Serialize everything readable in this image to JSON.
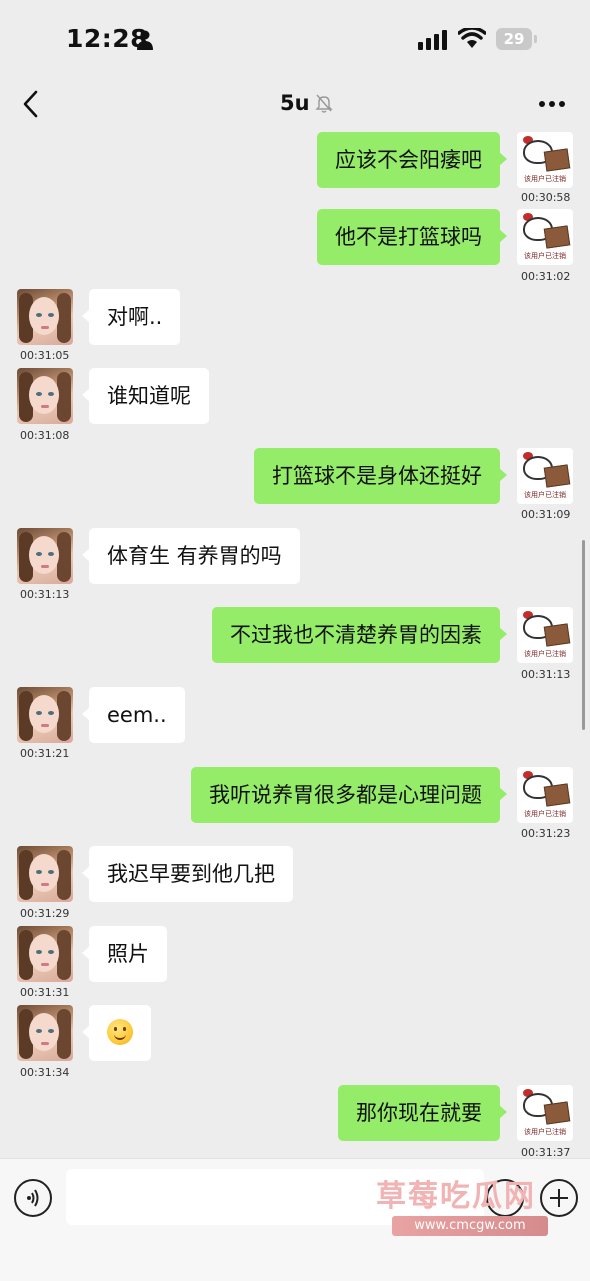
{
  "status_bar": {
    "time": "12:28",
    "battery": "29"
  },
  "header": {
    "title": "5u"
  },
  "watermark": {
    "text": "草莓吃瓜网",
    "url": "www.cmcgw.com"
  },
  "messages": [
    {
      "side": "out",
      "text": "应该不会阳痿吧",
      "time": "00:30:58"
    },
    {
      "side": "out",
      "text": "他不是打篮球吗",
      "time": "00:31:02"
    },
    {
      "side": "in",
      "text": "对啊..",
      "time": "00:31:05"
    },
    {
      "side": "in",
      "text": "谁知道呢",
      "time": "00:31:08"
    },
    {
      "side": "out",
      "text": "打篮球不是身体还挺好",
      "time": "00:31:09"
    },
    {
      "side": "in",
      "text": "体育生 有养胃的吗",
      "time": "00:31:13"
    },
    {
      "side": "out",
      "text": "不过我也不清楚养胃的因素",
      "time": "00:31:13"
    },
    {
      "side": "in",
      "text": "eem..",
      "time": "00:31:21"
    },
    {
      "side": "out",
      "text": "我听说养胃很多都是心理问题",
      "time": "00:31:23"
    },
    {
      "side": "in",
      "text": "我迟早要到他几把",
      "time": "00:31:29"
    },
    {
      "side": "in",
      "text": "照片",
      "time": "00:31:31"
    },
    {
      "side": "in",
      "text": "",
      "emoji": "smile-emoji",
      "time": "00:31:34"
    },
    {
      "side": "out",
      "text": "那你现在就要",
      "time": "00:31:37"
    }
  ],
  "avatar_caption": "该用户已注销",
  "colors": {
    "background": "#ededed",
    "outgoing_bubble": "#95ec69",
    "incoming_bubble": "#ffffff"
  },
  "icons": [
    "back-icon",
    "mute-bell-icon",
    "more-icon",
    "person-icon",
    "signal-icon",
    "wifi-icon",
    "voice-icon",
    "emoji-icon",
    "plus-icon"
  ]
}
